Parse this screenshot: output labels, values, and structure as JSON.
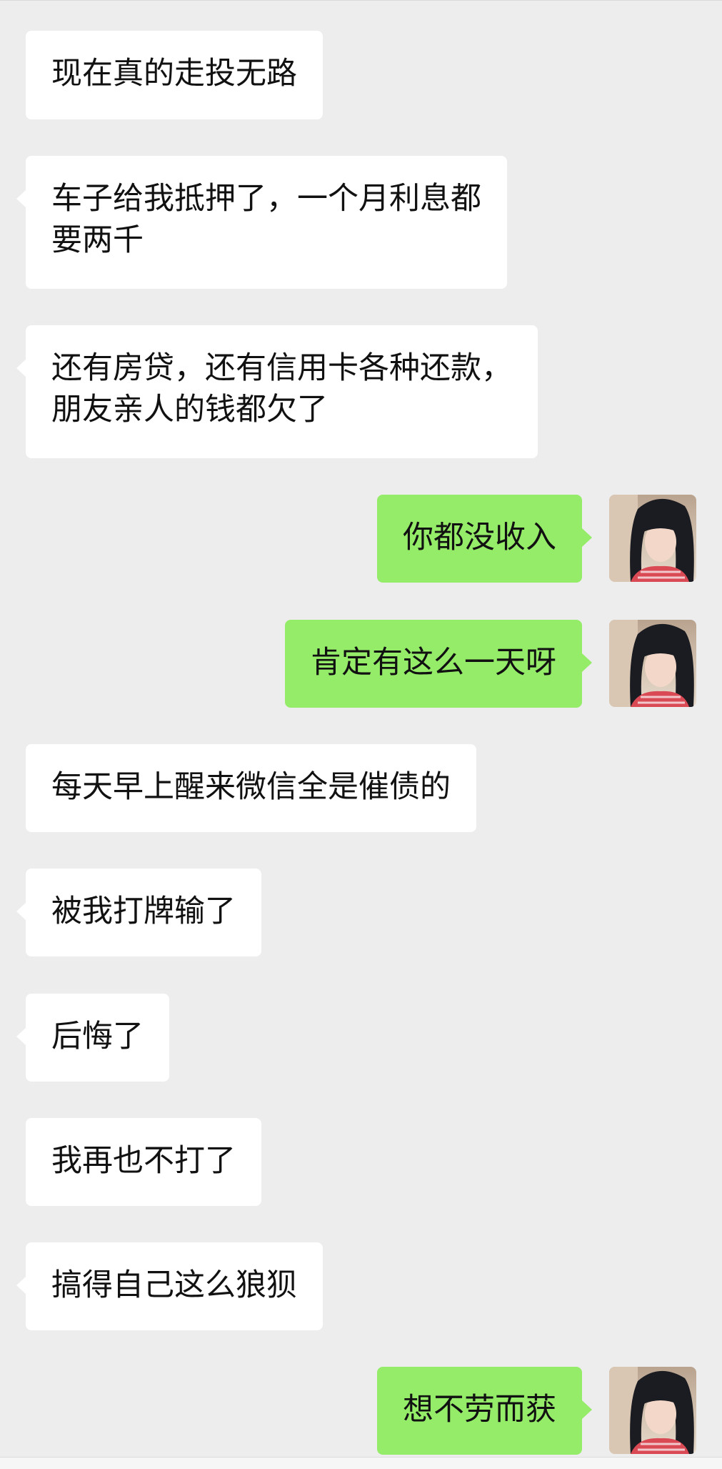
{
  "chat": {
    "messages": [
      {
        "side": "in",
        "text": "现在真的走投无路"
      },
      {
        "side": "in",
        "text": "车子给我抵押了，一个月利息都\n要两千"
      },
      {
        "side": "in",
        "text": "还有房贷，还有信用卡各种还款，\n朋友亲人的钱都欠了"
      },
      {
        "side": "out",
        "text": "你都没收入",
        "avatar": "user-avatar"
      },
      {
        "side": "out",
        "text": "肯定有这么一天呀",
        "avatar": "user-avatar"
      },
      {
        "side": "in",
        "text": "每天早上醒来微信全是催债的"
      },
      {
        "side": "in",
        "text": "被我打牌输了"
      },
      {
        "side": "in",
        "text": "后悔了"
      },
      {
        "side": "in",
        "text": "我再也不打了"
      },
      {
        "side": "in",
        "text": "搞得自己这么狼狈"
      },
      {
        "side": "out",
        "text": "想不劳而获",
        "avatar": "user-avatar"
      }
    ]
  },
  "colors": {
    "background": "#ededed",
    "incoming_bubble": "#ffffff",
    "outgoing_bubble": "#95ec69",
    "text": "#111111"
  }
}
